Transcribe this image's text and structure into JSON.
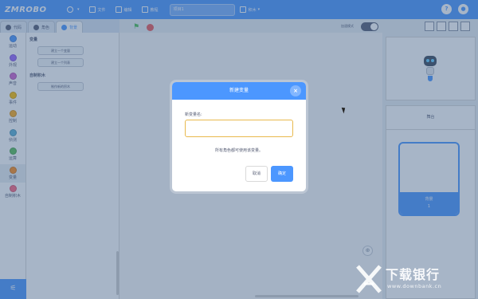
{
  "menubar": {
    "logo": "ZMROBO",
    "language_icon": "globe-icon",
    "file_label": "文件",
    "edit_label": "编辑",
    "tutorial_label": "教程",
    "project_title": "项目1",
    "connect_label": "积木",
    "help_icon": "?",
    "account_icon": "account-icon"
  },
  "tabs": [
    {
      "label": "代码",
      "icon": "code-icon"
    },
    {
      "label": "角色",
      "icon": "costume-icon"
    },
    {
      "label": "背景",
      "icon": "sound-icon"
    }
  ],
  "stage_controls": {
    "turbo_label": "加速模式"
  },
  "categories": [
    {
      "label": "运动",
      "color": "#4c97ff"
    },
    {
      "label": "外观",
      "color": "#9966ff"
    },
    {
      "label": "声音",
      "color": "#cf63cf"
    },
    {
      "label": "事件",
      "color": "#ffbf00"
    },
    {
      "label": "控制",
      "color": "#ffab19"
    },
    {
      "label": "侦测",
      "color": "#5cb1d6"
    },
    {
      "label": "运算",
      "color": "#59c059"
    },
    {
      "label": "变量",
      "color": "#ff8c1a"
    },
    {
      "label": "自制积木",
      "color": "#ff6680"
    }
  ],
  "palette": {
    "variables_heading": "变量",
    "make_variable": "建立一个变量",
    "make_list": "建立一个列表",
    "my_blocks_heading": "自制积木",
    "make_block": "制作新的积木"
  },
  "stage": {
    "label": "舞台",
    "backdrop_label": "背景",
    "backdrop_count": "1"
  },
  "modal": {
    "title": "新建变量",
    "close_icon": "×",
    "field_label": "新变量名:",
    "input_value": "",
    "hint": "所有角色都可使用该变量。",
    "cancel_label": "取消",
    "ok_label": "确定"
  },
  "watermark": {
    "text": "下载银行",
    "url": "www.downbank.cn"
  }
}
